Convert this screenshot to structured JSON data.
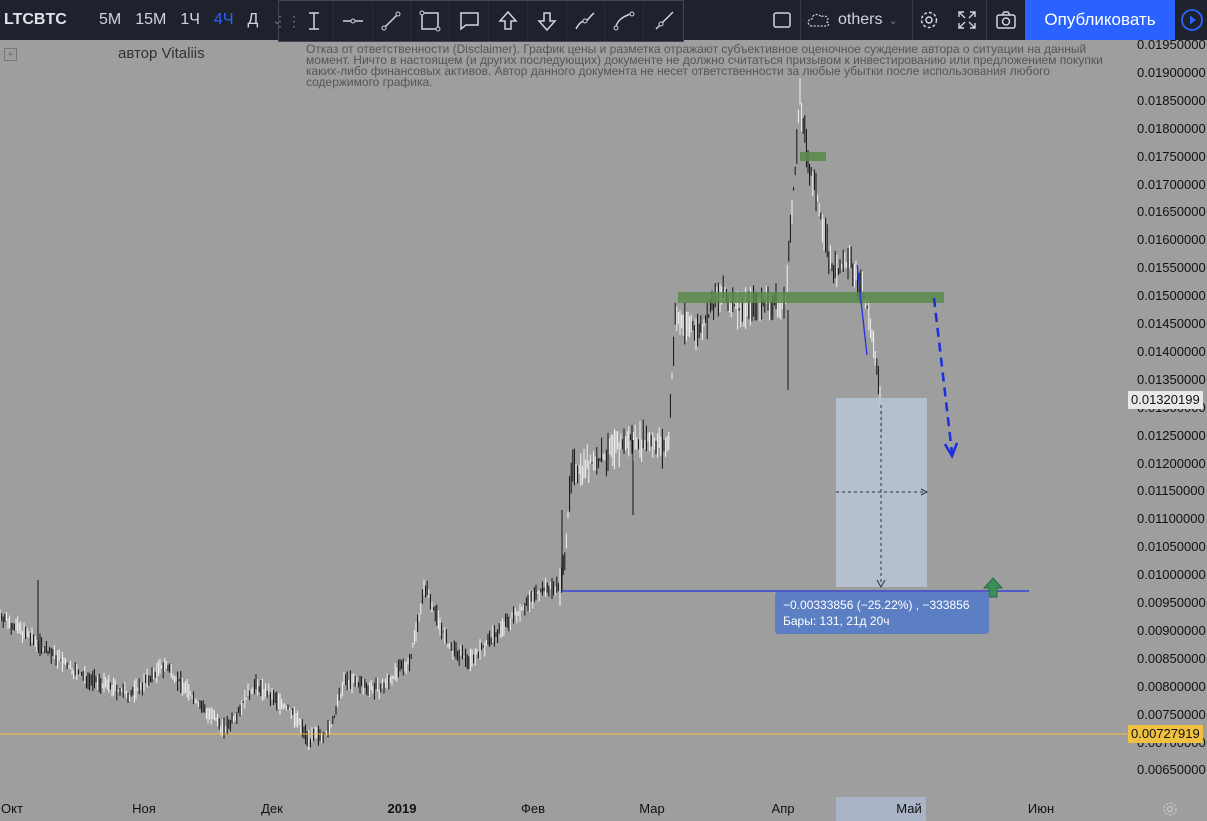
{
  "toolbar": {
    "symbol": "LTCBTC",
    "intervals": [
      {
        "label": "5М",
        "active": false
      },
      {
        "label": "15М",
        "active": false
      },
      {
        "label": "1Ч",
        "active": false
      },
      {
        "label": "4Ч",
        "active": true
      },
      {
        "label": "Д",
        "active": false
      }
    ],
    "others_label": "others",
    "publish_label": "Опубликовать"
  },
  "drawing_tools": [
    "text-cursor-icon",
    "horizontal-line-icon",
    "trend-line-icon",
    "rectangle-icon",
    "callout-icon",
    "arrow-up-icon",
    "arrow-down-icon",
    "brush-icon",
    "path-icon",
    "ray-icon"
  ],
  "legend": {
    "author": "автор Vitaliis",
    "disclaimer": "Отказ от ответственности (Disclaimer). График цены и разметка отражают субъективное оценочное суждение автора о ситуации на данный момент. Ничто в настоящем (и других последующих) документе не должно считаться призывом к инвестированию или предложением покупки каких-либо финансовых активов. Автор данного документа не несет ответственности за любые убытки после использования любого содержимого графика."
  },
  "price_scale": {
    "ticks": [
      "0.01950000",
      "0.01900000",
      "0.01850000",
      "0.01800000",
      "0.01750000",
      "0.01700000",
      "0.01650000",
      "0.01600000",
      "0.01550000",
      "0.01500000",
      "0.01450000",
      "0.01400000",
      "0.01350000",
      "0.01300000",
      "0.01250000",
      "0.01200000",
      "0.01150000",
      "0.01100000",
      "0.01050000",
      "0.01000000",
      "0.00950000",
      "0.00900000",
      "0.00850000",
      "0.00800000",
      "0.00750000",
      "0.00700000",
      "0.00650000"
    ],
    "current_price": "0.01320199",
    "level_price": "0.00727919"
  },
  "time_scale": {
    "ticks": [
      {
        "label": "Окт",
        "bold": false
      },
      {
        "label": "Ноя",
        "bold": false
      },
      {
        "label": "Дек",
        "bold": false
      },
      {
        "label": "2019",
        "bold": true
      },
      {
        "label": "Фев",
        "bold": false
      },
      {
        "label": "Мар",
        "bold": false
      },
      {
        "label": "Апр",
        "bold": false
      },
      {
        "label": "Май",
        "bold": false
      },
      {
        "label": "Июн",
        "bold": false
      }
    ]
  },
  "measure": {
    "line1": "−0.00333856 (−25.22%) , −333856",
    "line2": "Бары: 131, 21д 20ч"
  },
  "colors": {
    "background": "#9e9e9e",
    "toolbar": "#1e222d",
    "accent": "#2962ff",
    "zone": "#5a8a4a",
    "level_line": "#f0c040",
    "blue_line": "#2233dd"
  }
}
